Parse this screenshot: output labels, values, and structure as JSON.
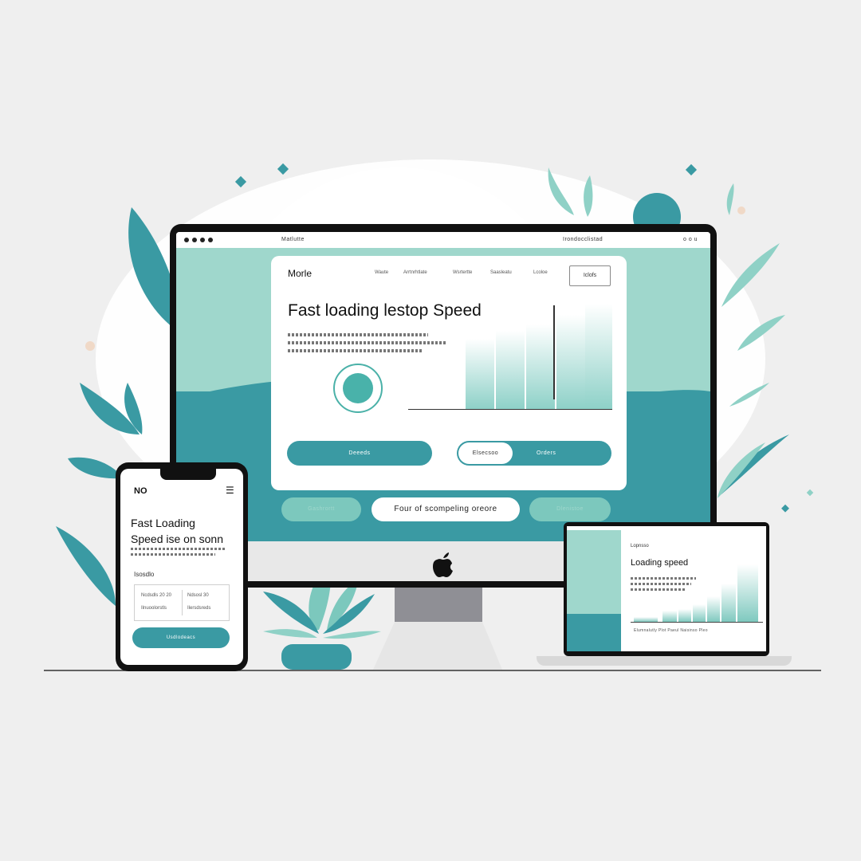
{
  "colors": {
    "teal": "#3a9aa3",
    "mint": "#9fd7cc",
    "background": "#efefef",
    "dark": "#111111"
  },
  "desktop": {
    "browser_left_text": "Matlutte",
    "browser_right_text": "Irondocclistad",
    "browser_menu_text": "o o u",
    "logo": "Morle",
    "nav": [
      "Waute",
      "Arrtnrhtlate",
      "Wsrtertte",
      "Saasleatu",
      "Lcoloe"
    ],
    "login_label": "Iclofs",
    "hero_title": "Fast loading lestop Speed",
    "primary_button": "Deeeds",
    "toggle_left": "Elsecsoo",
    "toggle_right": "Orders",
    "strip_left": "Gashrortt",
    "strip_center": "Four of scompeling oreore",
    "strip_right": "Dlenistoe",
    "apple_logo": "apple-icon"
  },
  "phone": {
    "logo": "NO",
    "title_line1": "Fast Loading",
    "title_line2": "Speed ise on sonn",
    "label": "Isosdlo",
    "stat_left": "Ncdsdls 20 20",
    "stat_right": "Ndsosl 30",
    "stat_left_sub": "Ilnuoolorstls",
    "stat_right_sub": "Ilersdsreds",
    "button": "Usdlodeacs"
  },
  "laptop": {
    "small_label": "Lopnsso",
    "title": "Loading speed",
    "footer_text": "Elumnalutly  Plot  Paeul  Naisinso  Pleo"
  }
}
